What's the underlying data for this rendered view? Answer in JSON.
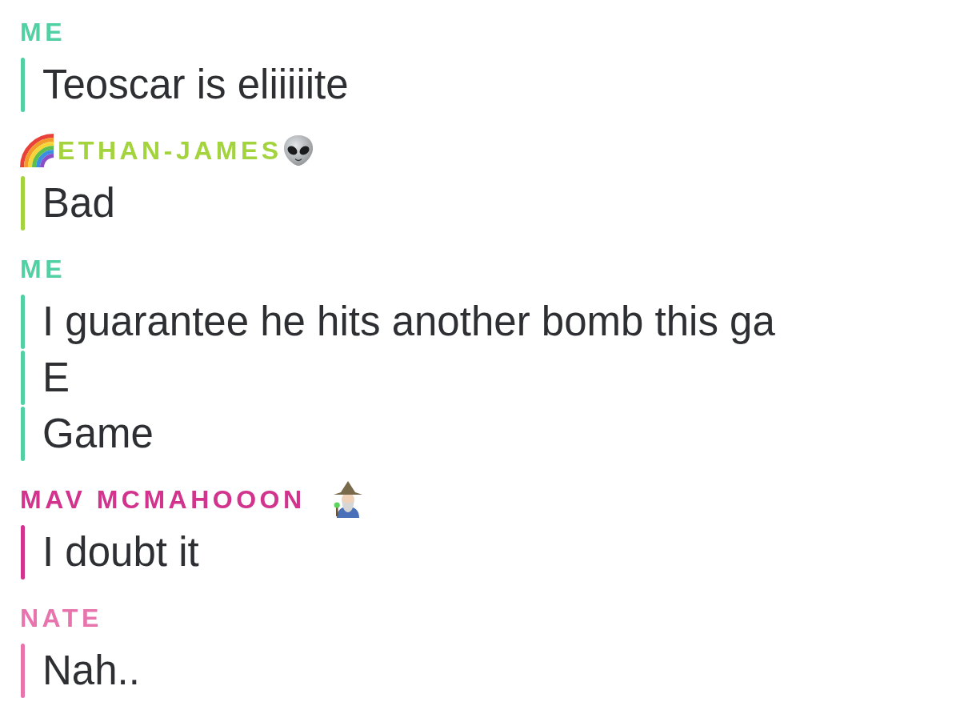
{
  "messages": [
    {
      "sender": {
        "name": "ME"
      },
      "color": "#53cfa4",
      "lines": [
        "Teoscar is eliiiiite"
      ]
    },
    {
      "sender": {
        "name": "ETHAN-JAMES",
        "icons_before": [
          {
            "kind": "rainbow"
          }
        ],
        "icons_after": [
          {
            "kind": "alien"
          }
        ]
      },
      "color": "#a3d33d",
      "lines": [
        "Bad"
      ]
    },
    {
      "sender": {
        "name": "ME"
      },
      "color": "#53cfa4",
      "lines": [
        "I guarantee he hits another bomb this ga",
        "E",
        "Game"
      ]
    },
    {
      "sender": {
        "name": "MAV MCMAHOOON",
        "icons_after": [
          {
            "kind": "wizard"
          }
        ]
      },
      "color": "#d1338d",
      "lines": [
        "I doubt it"
      ]
    },
    {
      "sender": {
        "name": "NATE"
      },
      "color": "#e874ae",
      "lines": [
        "Nah.."
      ]
    }
  ]
}
